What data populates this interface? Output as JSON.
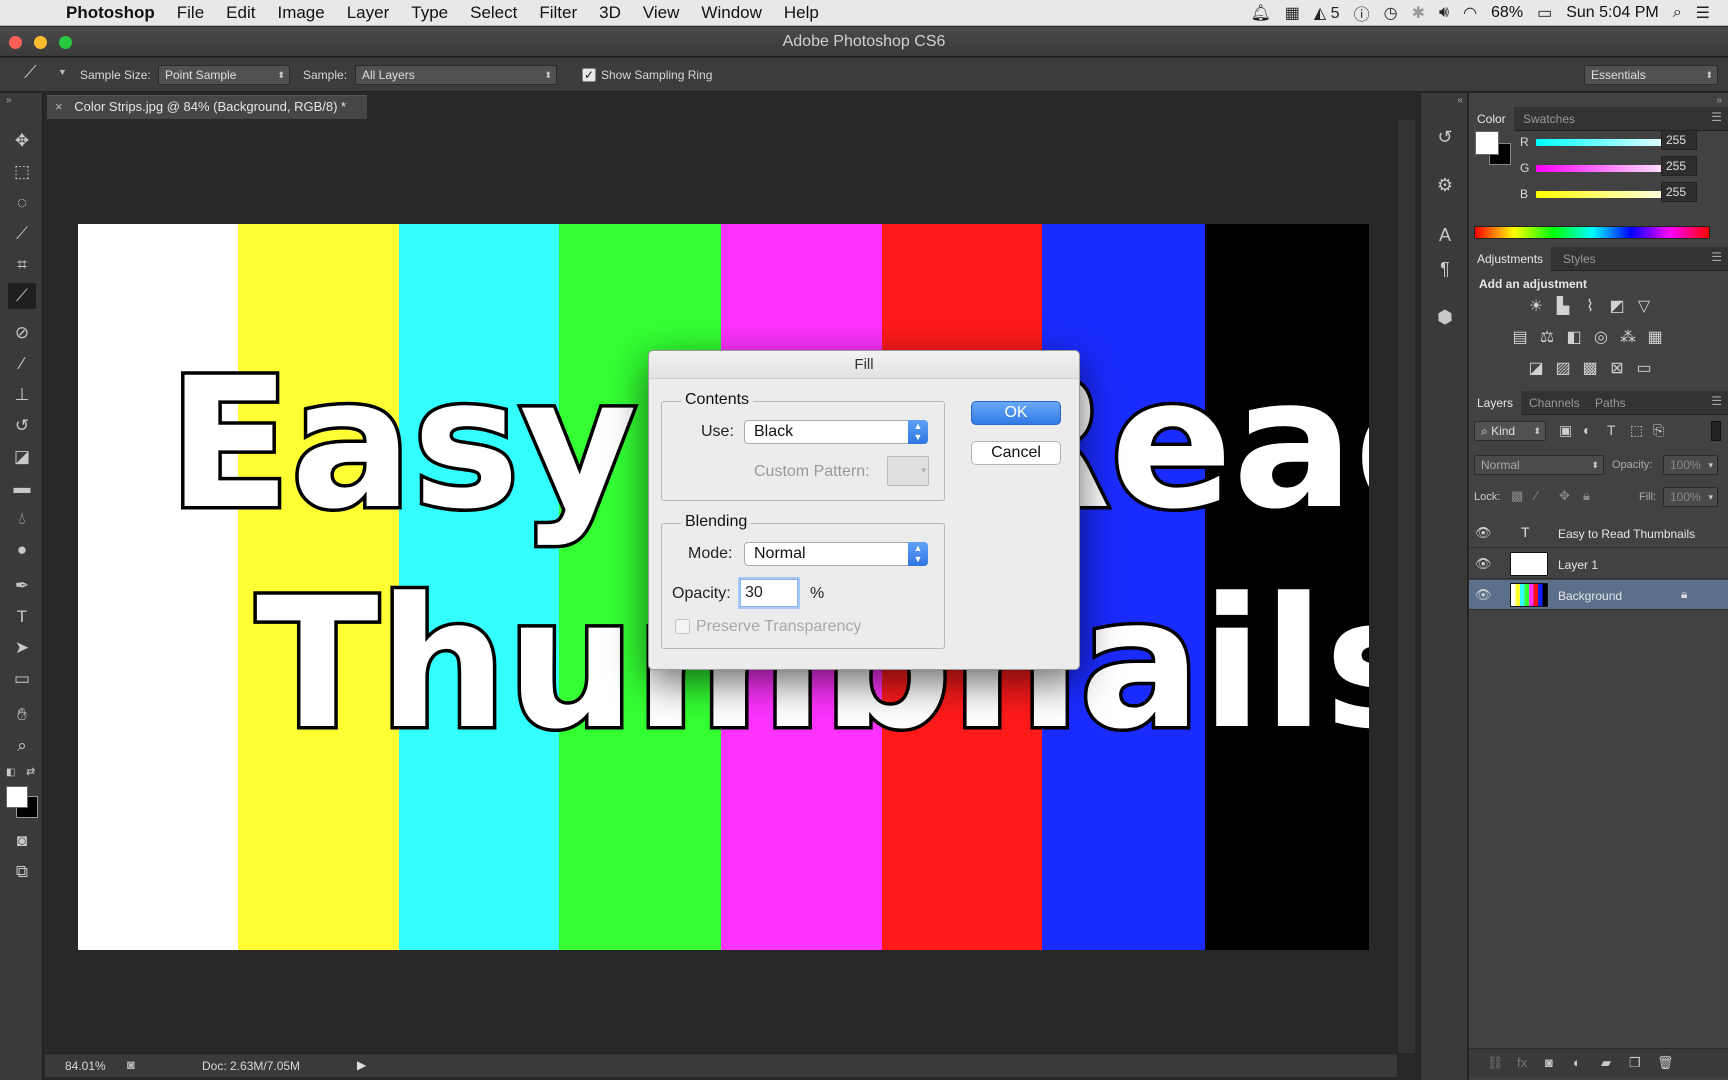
{
  "menubar": {
    "app": "Photoshop",
    "items": [
      "File",
      "Edit",
      "Image",
      "Layer",
      "Type",
      "Select",
      "Filter",
      "3D",
      "View",
      "Window",
      "Help"
    ],
    "notif_count": "5",
    "battery": "68%",
    "clock": "Sun 5:04 PM"
  },
  "window": {
    "title": "Adobe Photoshop CS6"
  },
  "options": {
    "sample_size_label": "Sample Size:",
    "sample_size_value": "Point Sample",
    "sample_label": "Sample:",
    "sample_value": "All Layers",
    "sampling_ring_label": "Show Sampling Ring",
    "workspace": "Essentials"
  },
  "document": {
    "tab_title": "Color Strips.jpg @ 84% (Background, RGB/8) *",
    "image_text_line1": "Easy to Read",
    "image_text_line2": "Thumbnails",
    "strip_colors": [
      "#ffffff",
      "#ffff33",
      "#33ffff",
      "#33ff33",
      "#ff33ff",
      "#ff1a1a",
      "#1a2bff",
      "#000000"
    ]
  },
  "status": {
    "zoom": "84.01%",
    "doc": "Doc: 2.63M/7.05M"
  },
  "color_panel": {
    "tabs": [
      "Color",
      "Swatches"
    ],
    "r_label": "R",
    "g_label": "G",
    "b_label": "B",
    "r_value": "255",
    "g_value": "255",
    "b_value": "255"
  },
  "adjustments_panel": {
    "tabs": [
      "Adjustments",
      "Styles"
    ],
    "heading": "Add an adjustment"
  },
  "layers_panel": {
    "tabs": [
      "Layers",
      "Channels",
      "Paths"
    ],
    "kind_label": "Kind",
    "blend_mode": "Normal",
    "opacity_label": "Opacity:",
    "opacity_value": "100%",
    "lock_label": "Lock:",
    "fill_label": "Fill:",
    "fill_value": "100%",
    "layers": [
      {
        "name": "Easy to Read Thumbnails",
        "type": "text"
      },
      {
        "name": "Layer 1",
        "type": "pixel"
      },
      {
        "name": "Background",
        "type": "background",
        "selected": true
      }
    ]
  },
  "fill_dialog": {
    "title": "Fill",
    "contents_label": "Contents",
    "use_label": "Use:",
    "use_value": "Black",
    "custom_pattern_label": "Custom Pattern:",
    "blending_label": "Blending",
    "mode_label": "Mode:",
    "mode_value": "Normal",
    "opacity_label": "Opacity:",
    "opacity_value": "30",
    "opacity_unit": "%",
    "preserve_label": "Preserve Transparency",
    "ok_label": "OK",
    "cancel_label": "Cancel"
  }
}
